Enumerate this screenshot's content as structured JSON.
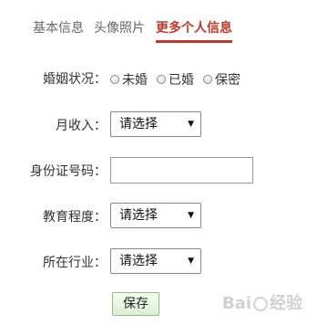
{
  "tabs": [
    {
      "label": "基本信息",
      "active": false
    },
    {
      "label": "头像照片",
      "active": false
    },
    {
      "label": "更多个人信息",
      "active": true
    }
  ],
  "accent_color": "#c0392b",
  "marital": {
    "label": "婚姻状况：",
    "options": [
      "未婚",
      "已婚",
      "保密"
    ]
  },
  "income": {
    "label": "月收入：",
    "value": "请选择"
  },
  "id_number": {
    "label": "身份证号码：",
    "value": ""
  },
  "education": {
    "label": "教育程度：",
    "value": "请选择"
  },
  "industry": {
    "label": "所在行业：",
    "value": "请选择"
  },
  "save_label": "保存",
  "watermark": {
    "text_left": "Bai",
    "text_right": "经验"
  }
}
